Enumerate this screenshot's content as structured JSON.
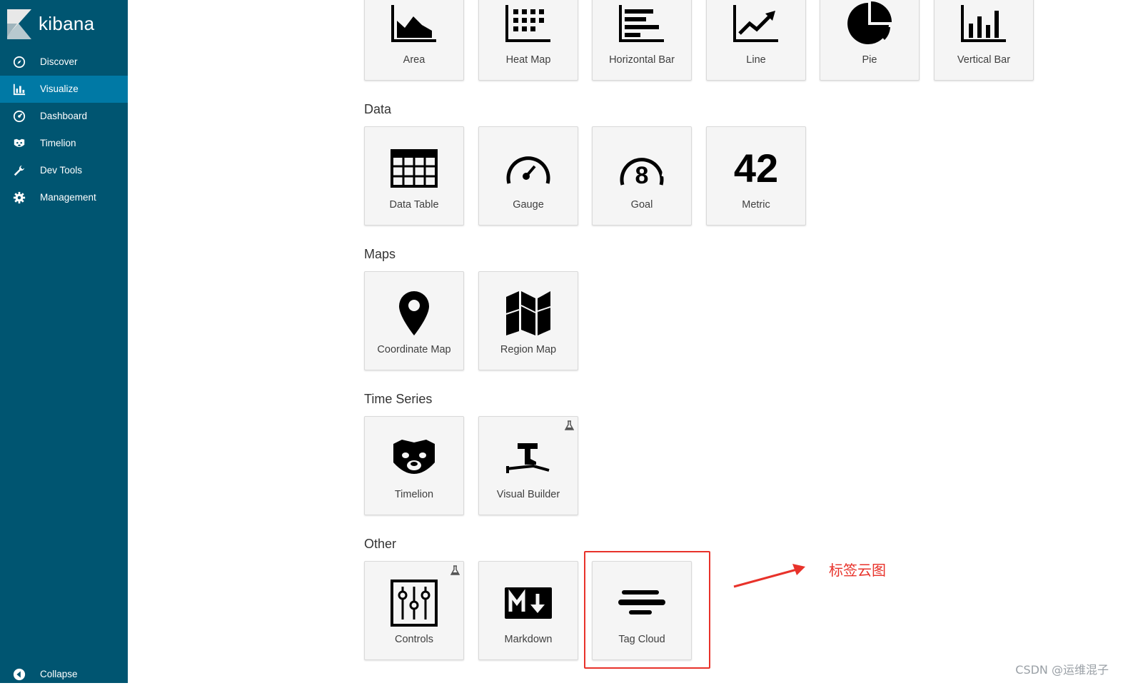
{
  "brand": {
    "name": "kibana"
  },
  "sidebar": {
    "items": [
      {
        "label": "Discover",
        "icon": "compass-icon"
      },
      {
        "label": "Visualize",
        "icon": "bar-chart-icon",
        "active": true
      },
      {
        "label": "Dashboard",
        "icon": "dashboard-gauge-icon"
      },
      {
        "label": "Timelion",
        "icon": "timelion-bear-icon"
      },
      {
        "label": "Dev Tools",
        "icon": "wrench-icon"
      },
      {
        "label": "Management",
        "icon": "gear-icon"
      }
    ],
    "collapse_label": "Collapse"
  },
  "sections": {
    "basic": {
      "tiles": [
        "Area",
        "Heat Map",
        "Horizontal Bar",
        "Line",
        "Pie",
        "Vertical Bar"
      ]
    },
    "data": {
      "title": "Data",
      "tiles": [
        "Data Table",
        "Gauge",
        "Goal",
        "Metric"
      ]
    },
    "maps": {
      "title": "Maps",
      "tiles": [
        "Coordinate Map",
        "Region Map"
      ]
    },
    "time_series": {
      "title": "Time Series",
      "tiles": [
        "Timelion",
        "Visual Builder"
      ]
    },
    "other": {
      "title": "Other",
      "tiles": [
        "Controls",
        "Markdown",
        "Tag Cloud"
      ]
    }
  },
  "icon_text": {
    "metric_number": "42",
    "goal_number": "8"
  },
  "annotation": {
    "text": "标签云图",
    "color": "#e8322a"
  },
  "watermark": "CSDN @运维混子",
  "colors": {
    "sidebar": "#005571",
    "sidebar_active": "#0079a5",
    "tile_bg": "#f5f5f5"
  }
}
